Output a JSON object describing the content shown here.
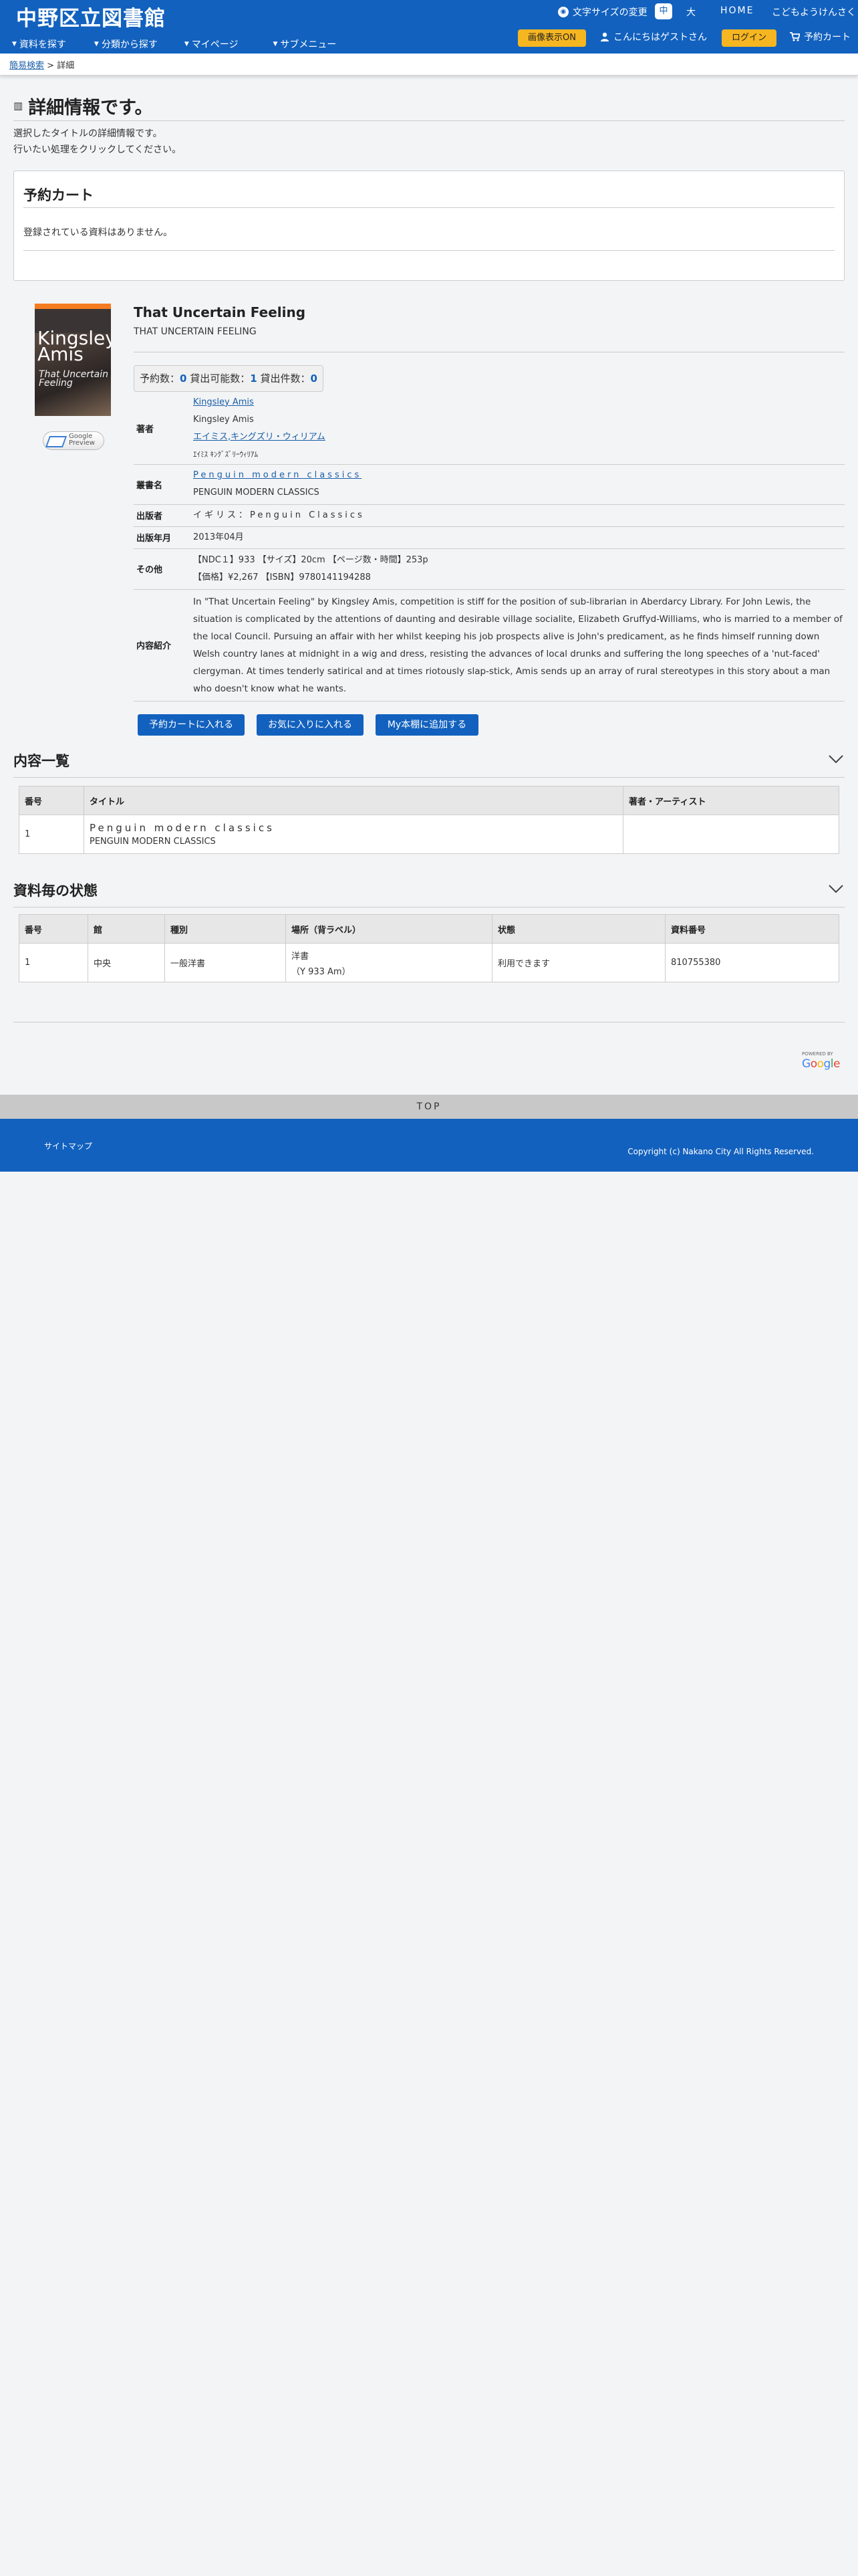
{
  "header": {
    "logo": "中野区立図書館",
    "font_size_label": "文字サイズの変更",
    "font_size_mid": "中",
    "font_size_big": "大",
    "home": "HOME",
    "kids": "こどもようけんさく",
    "image_button": "画像表示ON",
    "greeting": "こんにちはゲストさん",
    "login": "ログイン",
    "cart": "予約カート",
    "nav": [
      "資料を探す",
      "分類から探す",
      "マイページ",
      "サブメニュー"
    ]
  },
  "breadcrumb": {
    "link": "簡易検索",
    "separator": ">",
    "current": "詳細"
  },
  "page": {
    "title": "詳細情報です。",
    "lead1": "選択したタイトルの詳細情報です。",
    "lead2": "行いたい処理をクリックしてください。"
  },
  "cart_box": {
    "title": "予約カート",
    "empty": "登録されている資料はありません。"
  },
  "book": {
    "cover_author": "Kingsley Amis",
    "cover_title": "That Uncertain Feeling",
    "google_badge": "Google Preview",
    "title": "That Uncertain Feeling",
    "subtitle": "THAT UNCERTAIN FEELING",
    "counts": {
      "reserve_label": "予約数：",
      "reserve": "0",
      "available_label": "貸出可能数：",
      "available": "1",
      "lent_label": "貸出件数：",
      "lent": "0"
    },
    "rows": {
      "author_label": "著者",
      "author_link": "Kingsley Amis",
      "author_plain": "Kingsley Amis",
      "author_ja": "エイミス,キングズリ・ウィリアム",
      "author_kana": "ｴｲﾐｽ ｷﾝｸﾞｽﾞﾘｰｳｨﾘｱﾑ",
      "series_label": "叢書名",
      "series_link": "Penguin modern classics",
      "series_plain": "PENGUIN MODERN CLASSICS",
      "publisher_label": "出版者",
      "publisher": "イギリス：Penguin Classics",
      "year_label": "出版年月",
      "year": "2013年04月",
      "other_label": "その他",
      "other1": "【NDC１】933 【サイズ】20cm 【ページ数・時間】253p",
      "other2": "【価格】¥2,267 【ISBN】9780141194288",
      "summary_label": "内容紹介",
      "summary": "In \"That Uncertain Feeling\" by Kingsley Amis, competition is stiff for the position of sub-librarian in Aberdarcy Library. For John Lewis, the situation is complicated by the attentions of daunting and desirable village socialite, Elizabeth Gruffyd-Williams, who is married to a member of the local Council. Pursuing an affair with her whilst keeping his job prospects alive is John's predicament, as he finds himself running down Welsh country lanes at midnight in a wig and dress, resisting the advances of local drunks and suffering the long speeches of a 'nut-faced' clergyman. At times tenderly satirical and at times riotously slap-stick, Amis sends up an array of rural stereotypes in this story about a man who doesn't know what he wants."
    },
    "buttons": [
      "予約カートに入れる",
      "お気に入りに入れる",
      "My本棚に追加する"
    ]
  },
  "contents": {
    "title": "内容一覧",
    "headers": [
      "番号",
      "タイトル",
      "著者・アーティスト"
    ],
    "rows": [
      {
        "no": "1",
        "title_main": "Penguin modern classics",
        "title_sub": "PENGUIN MODERN CLASSICS",
        "author": ""
      }
    ]
  },
  "holdings": {
    "title": "資料毎の状態",
    "headers": [
      "番号",
      "館",
      "種別",
      "場所（背ラベル）",
      "状態",
      "資料番号"
    ],
    "rows": [
      {
        "no": "1",
        "branch": "中央",
        "kind": "一般洋書",
        "location1": "洋書",
        "location2": "（Y 933 Am）",
        "status": "利用できます",
        "id": "810755380"
      }
    ]
  },
  "powered": {
    "label": "POWERED BY",
    "brand": "Google"
  },
  "top": "TOP",
  "footer": {
    "sitemap": "サイトマップ",
    "copyright": "Copyright (c) Nakano City All Rights Reserved."
  },
  "colors": {
    "brand_blue": "#1261be",
    "button_yellow": "#f5b621",
    "link_blue": "#1a5ea8"
  }
}
